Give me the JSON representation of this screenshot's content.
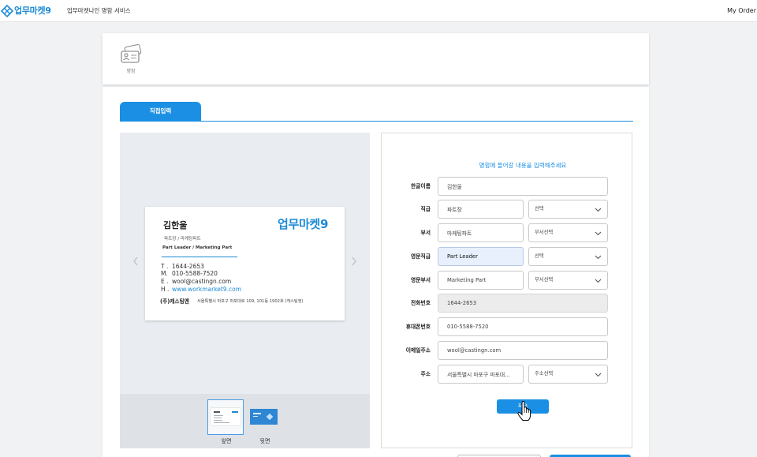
{
  "header": {
    "logo_icon": "diamond-logo-icon",
    "logo_text": "업무마켓9",
    "service_title": "업무마켓나인 명함 서비스",
    "my_order": "My Order"
  },
  "product": {
    "icon": "business-card-icon",
    "label": "명함"
  },
  "tabs": [
    {
      "label": "직접입력",
      "active": true
    }
  ],
  "preview": {
    "prev_icon": "chevron-left-icon",
    "next_icon": "chevron-right-icon",
    "card": {
      "name": "김한울",
      "logo_text": "업무마켓9",
      "title_ko": "파트장 / 마케팅파트",
      "title_en": "Part Leader / Marketing Part",
      "contacts": [
        {
          "prefix": "T .",
          "value": "1644-2653"
        },
        {
          "prefix": "M.",
          "value": "010-5588-7520"
        },
        {
          "prefix": "E .",
          "value": "wool@castingn.com"
        },
        {
          "prefix": "H .",
          "value": "www.workmarket9.com"
        }
      ],
      "company": "(주)캐스팅엔",
      "address": "서울특별시 마포구 마포대로 109, 101동 1902호 (캐스팅엔)"
    },
    "thumbnails": [
      {
        "label": "앞면",
        "selected": true
      },
      {
        "label": "뒷면",
        "selected": false
      }
    ]
  },
  "form": {
    "heading": "명함에 들어갈 내용을 입력해주세요",
    "rows": [
      {
        "label": "한글이름",
        "value": "김한울"
      },
      {
        "label": "직급",
        "value": "파트장",
        "select": "선택"
      },
      {
        "label": "부서",
        "value": "마케팅파트",
        "select": "부서선택"
      },
      {
        "label": "영문직급",
        "value": "Part Leader",
        "select": "선택",
        "highlighted": true
      },
      {
        "label": "영문부서",
        "value": "Marketing Part",
        "select": "부서선택"
      },
      {
        "label": "전화번호",
        "value": "1644-2653",
        "disabled": true
      },
      {
        "label": "휴대폰번호",
        "value": "010-5588-7520"
      },
      {
        "label": "이메일주소",
        "value": "wool@castingn.com"
      },
      {
        "label": "주소",
        "value": "서울특별시 마포구 마포대...",
        "select": "주소선택"
      }
    ],
    "select_icon": "chevron-down-icon",
    "apply_label": "적용"
  },
  "cursor": "hand-pointer-icon",
  "colors": {
    "accent": "#1a8fe3",
    "logo": "#1d8ad6",
    "highlighted_input_bg": "#e8f0fd",
    "disabled_input_bg": "#ececec",
    "preview_bg": "#e9ecf0"
  }
}
